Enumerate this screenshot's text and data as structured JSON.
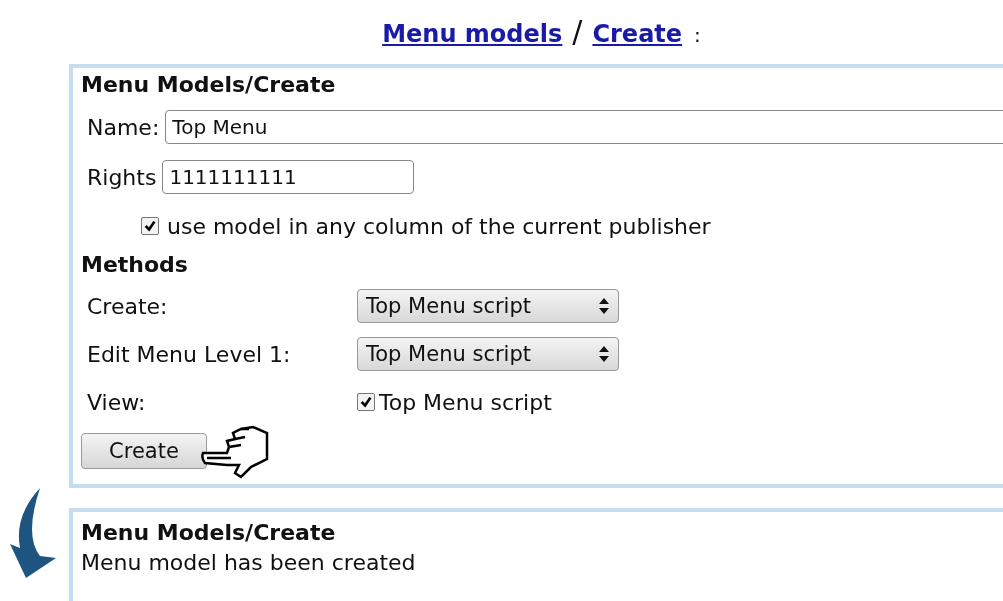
{
  "breadcrumb": {
    "links": [
      "Menu models",
      "Create"
    ],
    "separator": "/",
    "suffix": ":"
  },
  "form": {
    "title": "Menu Models/Create",
    "fields": [
      {
        "label": "Name:",
        "value": "Top Menu",
        "kind": "wide"
      },
      {
        "label": "Rights",
        "value": "1111111111",
        "kind": "short"
      }
    ],
    "option": {
      "label": "use model in any column of the current publisher",
      "checked": true
    },
    "methods": {
      "title": "Methods",
      "rows": [
        {
          "kind": "select",
          "label": "Create:",
          "value": "Top Menu script"
        },
        {
          "kind": "select",
          "label": "Edit Menu Level 1:",
          "value": "Top Menu script"
        },
        {
          "kind": "checkbox",
          "label": "View:",
          "value": "Top Menu script",
          "checked": true
        }
      ]
    },
    "button": "Create"
  },
  "result": {
    "title": "Menu Models/Create",
    "message": "Menu model has been created"
  }
}
